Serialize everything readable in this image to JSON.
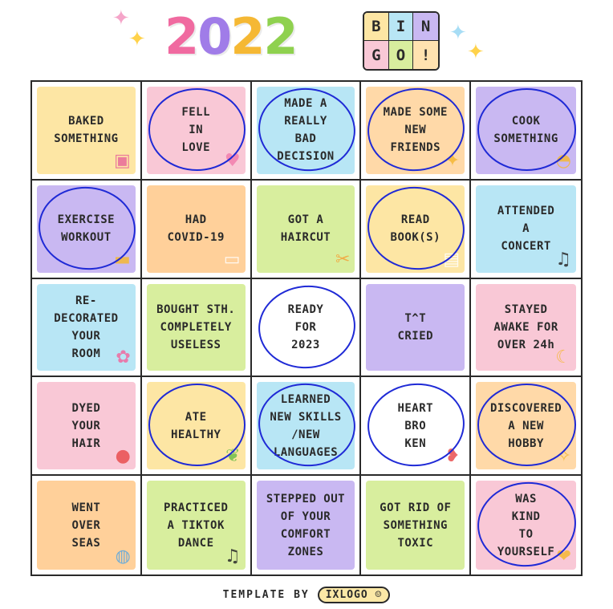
{
  "header": {
    "year_digits": [
      "2",
      "0",
      "2",
      "2"
    ],
    "year_colors": [
      "#f06aa0",
      "#a07ce8",
      "#f5b834",
      "#8fd14f"
    ],
    "bingo_letters": [
      "B",
      "I",
      "N",
      "G",
      "O",
      "!"
    ],
    "bingo_colors": [
      "#fde6a4",
      "#b8e6f5",
      "#c9b8f2",
      "#f9c8d6",
      "#d8ee9e",
      "#ffe2b0"
    ],
    "sparkle_colors": [
      "#f5a5c9",
      "#ffd24a",
      "#a7ddf5",
      "#ffd24a"
    ]
  },
  "grid": {
    "cells": [
      {
        "label": "BAKED\nSOMETHING",
        "color": "#fde6a4",
        "icon": "oven-icon",
        "circled": false
      },
      {
        "label": "FELL\nIN\nLOVE",
        "color": "#f9c8d6",
        "icon": "heart-icon",
        "circled": true
      },
      {
        "label": "MADE A\nREALLY\nBAD\nDECISION",
        "color": "#b8e6f5",
        "icon": "none",
        "circled": true
      },
      {
        "label": "MADE SOME\nNEW\nFRIENDS",
        "color": "#ffd9a8",
        "icon": "star-icon",
        "circled": true
      },
      {
        "label": "COOK\nSOMETHING",
        "color": "#c9b8f2",
        "icon": "pot-icon",
        "circled": true
      },
      {
        "label": "EXERCISE\nWORKOUT",
        "color": "#c9b8f2",
        "icon": "dumbbell-icon",
        "circled": true
      },
      {
        "label": "HAD\nCOVID-19",
        "color": "#ffd09a",
        "icon": "mask-icon",
        "circled": false
      },
      {
        "label": "GOT A\nHAIRCUT",
        "color": "#d8ee9e",
        "icon": "scissors-icon",
        "circled": false
      },
      {
        "label": "READ\nBOOK(S)",
        "color": "#fde6a4",
        "icon": "book-icon",
        "circled": true
      },
      {
        "label": "ATTENDED\nA\nCONCERT",
        "color": "#b8e6f5",
        "icon": "music-note-icon",
        "circled": false
      },
      {
        "label": "RE-\nDECORATED\nYOUR\nROOM",
        "color": "#b8e6f5",
        "icon": "plant-icon",
        "circled": false
      },
      {
        "label": "BOUGHT STH.\nCOMPLETELY\nUSELESS",
        "color": "#d8ee9e",
        "icon": "none",
        "circled": false
      },
      {
        "label": "READY\nFOR\n2023",
        "color": "#ffffff",
        "icon": "none",
        "circled": true
      },
      {
        "label": "T^T\nCRIED",
        "color": "#c9b8f2",
        "icon": "crying-face-icon",
        "circled": false
      },
      {
        "label": "STAYED\nAWAKE FOR\nOVER 24h",
        "color": "#f9c8d6",
        "icon": "moon-icon",
        "circled": false
      },
      {
        "label": "DYED\nYOUR\nHAIR",
        "color": "#f9c8d6",
        "icon": "drop-icon",
        "circled": false
      },
      {
        "label": "ATE\nHEALTHY",
        "color": "#fde6a4",
        "icon": "vegetable-icon",
        "circled": true
      },
      {
        "label": "LEARNED\nNEW SKILLS\n/NEW\nLANGUAGES",
        "color": "#b8e6f5",
        "icon": "none",
        "circled": true
      },
      {
        "label": "HEART\nBRO\nKEN",
        "color": "#ffffff",
        "icon": "broken-heart-icon",
        "circled": true
      },
      {
        "label": "DISCOVERED\nA NEW\nHOBBY",
        "color": "#ffd9a8",
        "icon": "sparkle-icon",
        "circled": true
      },
      {
        "label": "WENT\nOVER\nSEAS",
        "color": "#ffd09a",
        "icon": "globe-icon",
        "circled": false
      },
      {
        "label": "PRACTICED\nA TIKTOK\nDANCE",
        "color": "#d8ee9e",
        "icon": "music-note-icon",
        "circled": false
      },
      {
        "label": "STEPPED OUT\nOF YOUR\nCOMFORT\nZONES",
        "color": "#c9b8f2",
        "icon": "none",
        "circled": false
      },
      {
        "label": "GOT RID OF\nSOMETHING\nTOXIC",
        "color": "#d8ee9e",
        "icon": "none",
        "circled": false
      },
      {
        "label": "WAS\nKIND\nTO\nYOURSELF",
        "color": "#f9c8d6",
        "icon": "smiley-heart-icon",
        "circled": true
      }
    ]
  },
  "footer": {
    "template_label": "TEMPLATE BY",
    "author": "IXLOGO ☺"
  }
}
